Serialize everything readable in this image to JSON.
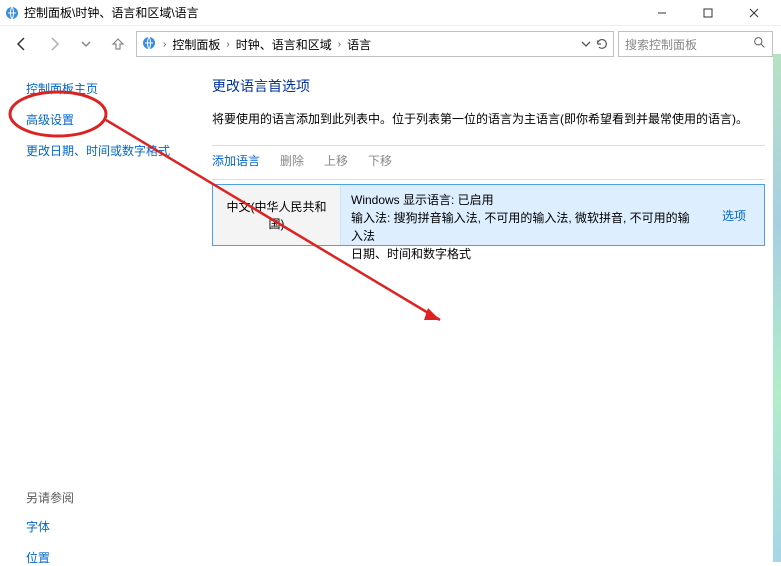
{
  "window": {
    "title": "控制面板\\时钟、语言和区域\\语言"
  },
  "breadcrumb": {
    "root": "控制面板",
    "mid": "时钟、语言和区域",
    "leaf": "语言"
  },
  "search": {
    "placeholder": "搜索控制面板"
  },
  "sidebar": {
    "home": "控制面板主页",
    "advanced": "高级设置",
    "datefmt": "更改日期、时间或数字格式",
    "see_also_label": "另请参阅",
    "fonts": "字体",
    "location": "位置"
  },
  "main": {
    "title": "更改语言首选项",
    "description": "将要使用的语言添加到此列表中。位于列表第一位的语言为主语言(即你希望看到并最常使用的语言)。",
    "actions": {
      "add": "添加语言",
      "remove": "删除",
      "up": "上移",
      "down": "下移"
    },
    "lang": {
      "name": "中文(中华人民共和国)",
      "display": "Windows 显示语言: 已启用",
      "ime": "输入法: 搜狗拼音输入法, 不可用的输入法, 微软拼音, 不可用的输入法",
      "datefmt": "日期、时间和数字格式",
      "options": "选项"
    }
  }
}
